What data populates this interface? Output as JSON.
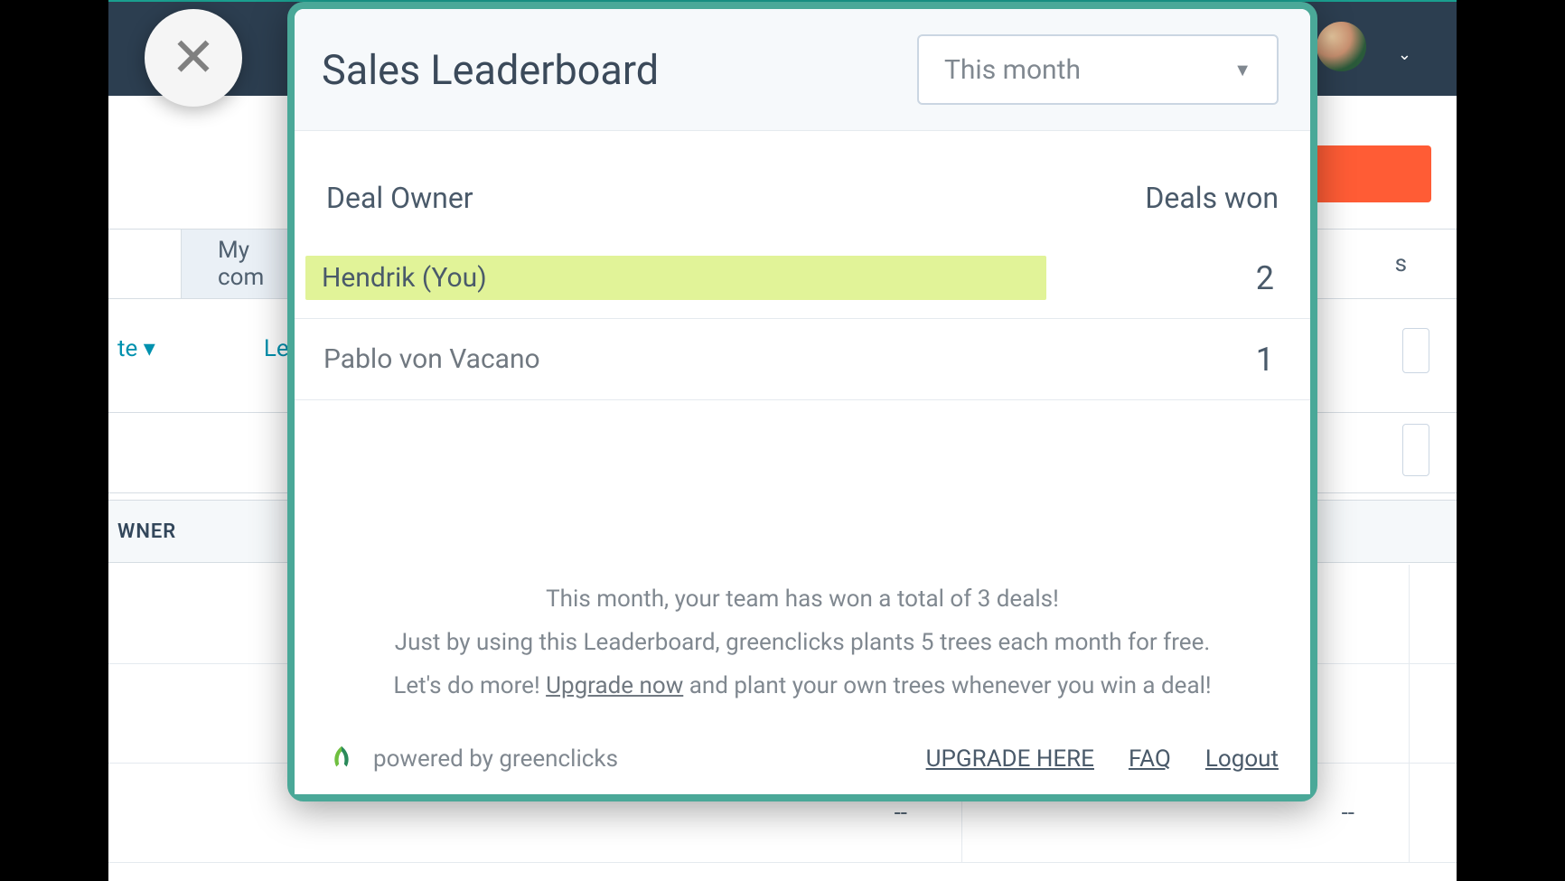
{
  "modal": {
    "title": "Sales Leaderboard",
    "period": "This month",
    "columns": {
      "owner": "Deal Owner",
      "won": "Deals won"
    },
    "rows": [
      {
        "name": "Hendrik (You)",
        "count": "2",
        "highlighted": true
      },
      {
        "name": "Pablo von Vacano",
        "count": "1",
        "highlighted": false
      }
    ],
    "message": {
      "line1": "This month, your team has won a total of 3 deals!",
      "line2": "Just by using this Leaderboard, greenclicks plants 5 trees each month for free.",
      "line3_pre": "Let's do more! ",
      "upgrade_inline": "Upgrade now",
      "line3_post": " and plant your own trees whenever you win a deal!"
    },
    "footer": {
      "powered_by": "powered by greenclicks",
      "upgrade": "UPGRADE HERE",
      "faq": "FAQ",
      "logout": "Logout"
    }
  },
  "background": {
    "tab_my": "My com",
    "filter_te": "te",
    "filter_lea": "Lea",
    "owner_header": "WNER",
    "cell_dash": "--",
    "s_fragment": "s"
  }
}
